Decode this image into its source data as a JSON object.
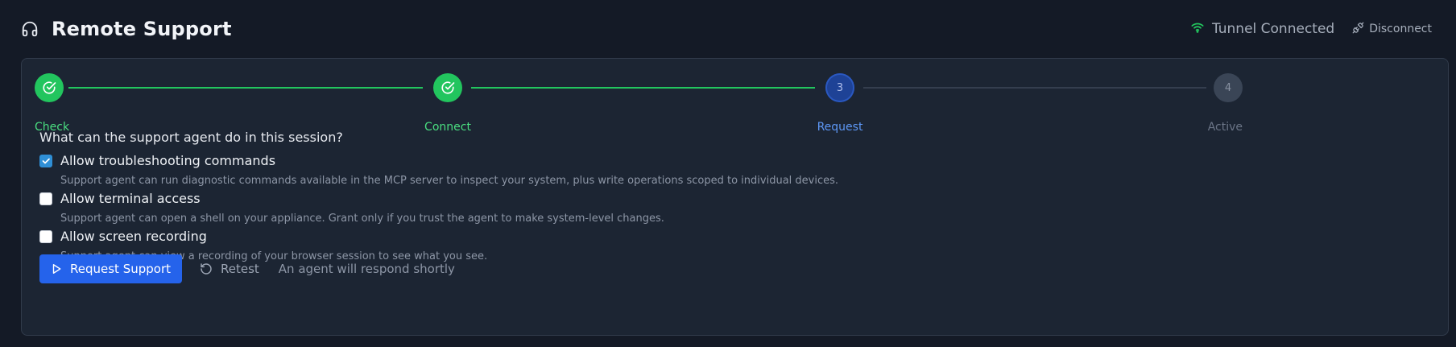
{
  "header": {
    "title": "Remote Support",
    "icon": "headphones-icon",
    "tunnel_status": "Tunnel Connected",
    "disconnect_label": "Disconnect"
  },
  "stepper": {
    "steps": [
      {
        "label": "Check",
        "number": "1",
        "state": "done"
      },
      {
        "label": "Connect",
        "number": "2",
        "state": "done"
      },
      {
        "label": "Request",
        "number": "3",
        "state": "current"
      },
      {
        "label": "Active",
        "number": "4",
        "state": "pending"
      }
    ]
  },
  "permissions": {
    "question": "What can the support agent do in this session?",
    "options": [
      {
        "label": "Allow troubleshooting commands",
        "description": "Support agent can run diagnostic commands available in the MCP server to inspect your system, plus write operations scoped to individual devices.",
        "checked": true
      },
      {
        "label": "Allow terminal access",
        "description": "Support agent can open a shell on your appliance. Grant only if you trust the agent to make system-level changes.",
        "checked": false
      },
      {
        "label": "Allow screen recording",
        "description": "Support agent can view a recording of your browser session to see what you see.",
        "checked": false
      }
    ]
  },
  "actions": {
    "request_label": "Request Support",
    "retest_label": "Retest",
    "hint": "An agent will respond shortly"
  },
  "colors": {
    "background": "#141a26",
    "card": "#1c2533",
    "success": "#22c55e",
    "primary": "#2563eb",
    "current_step": "#1e4296"
  }
}
